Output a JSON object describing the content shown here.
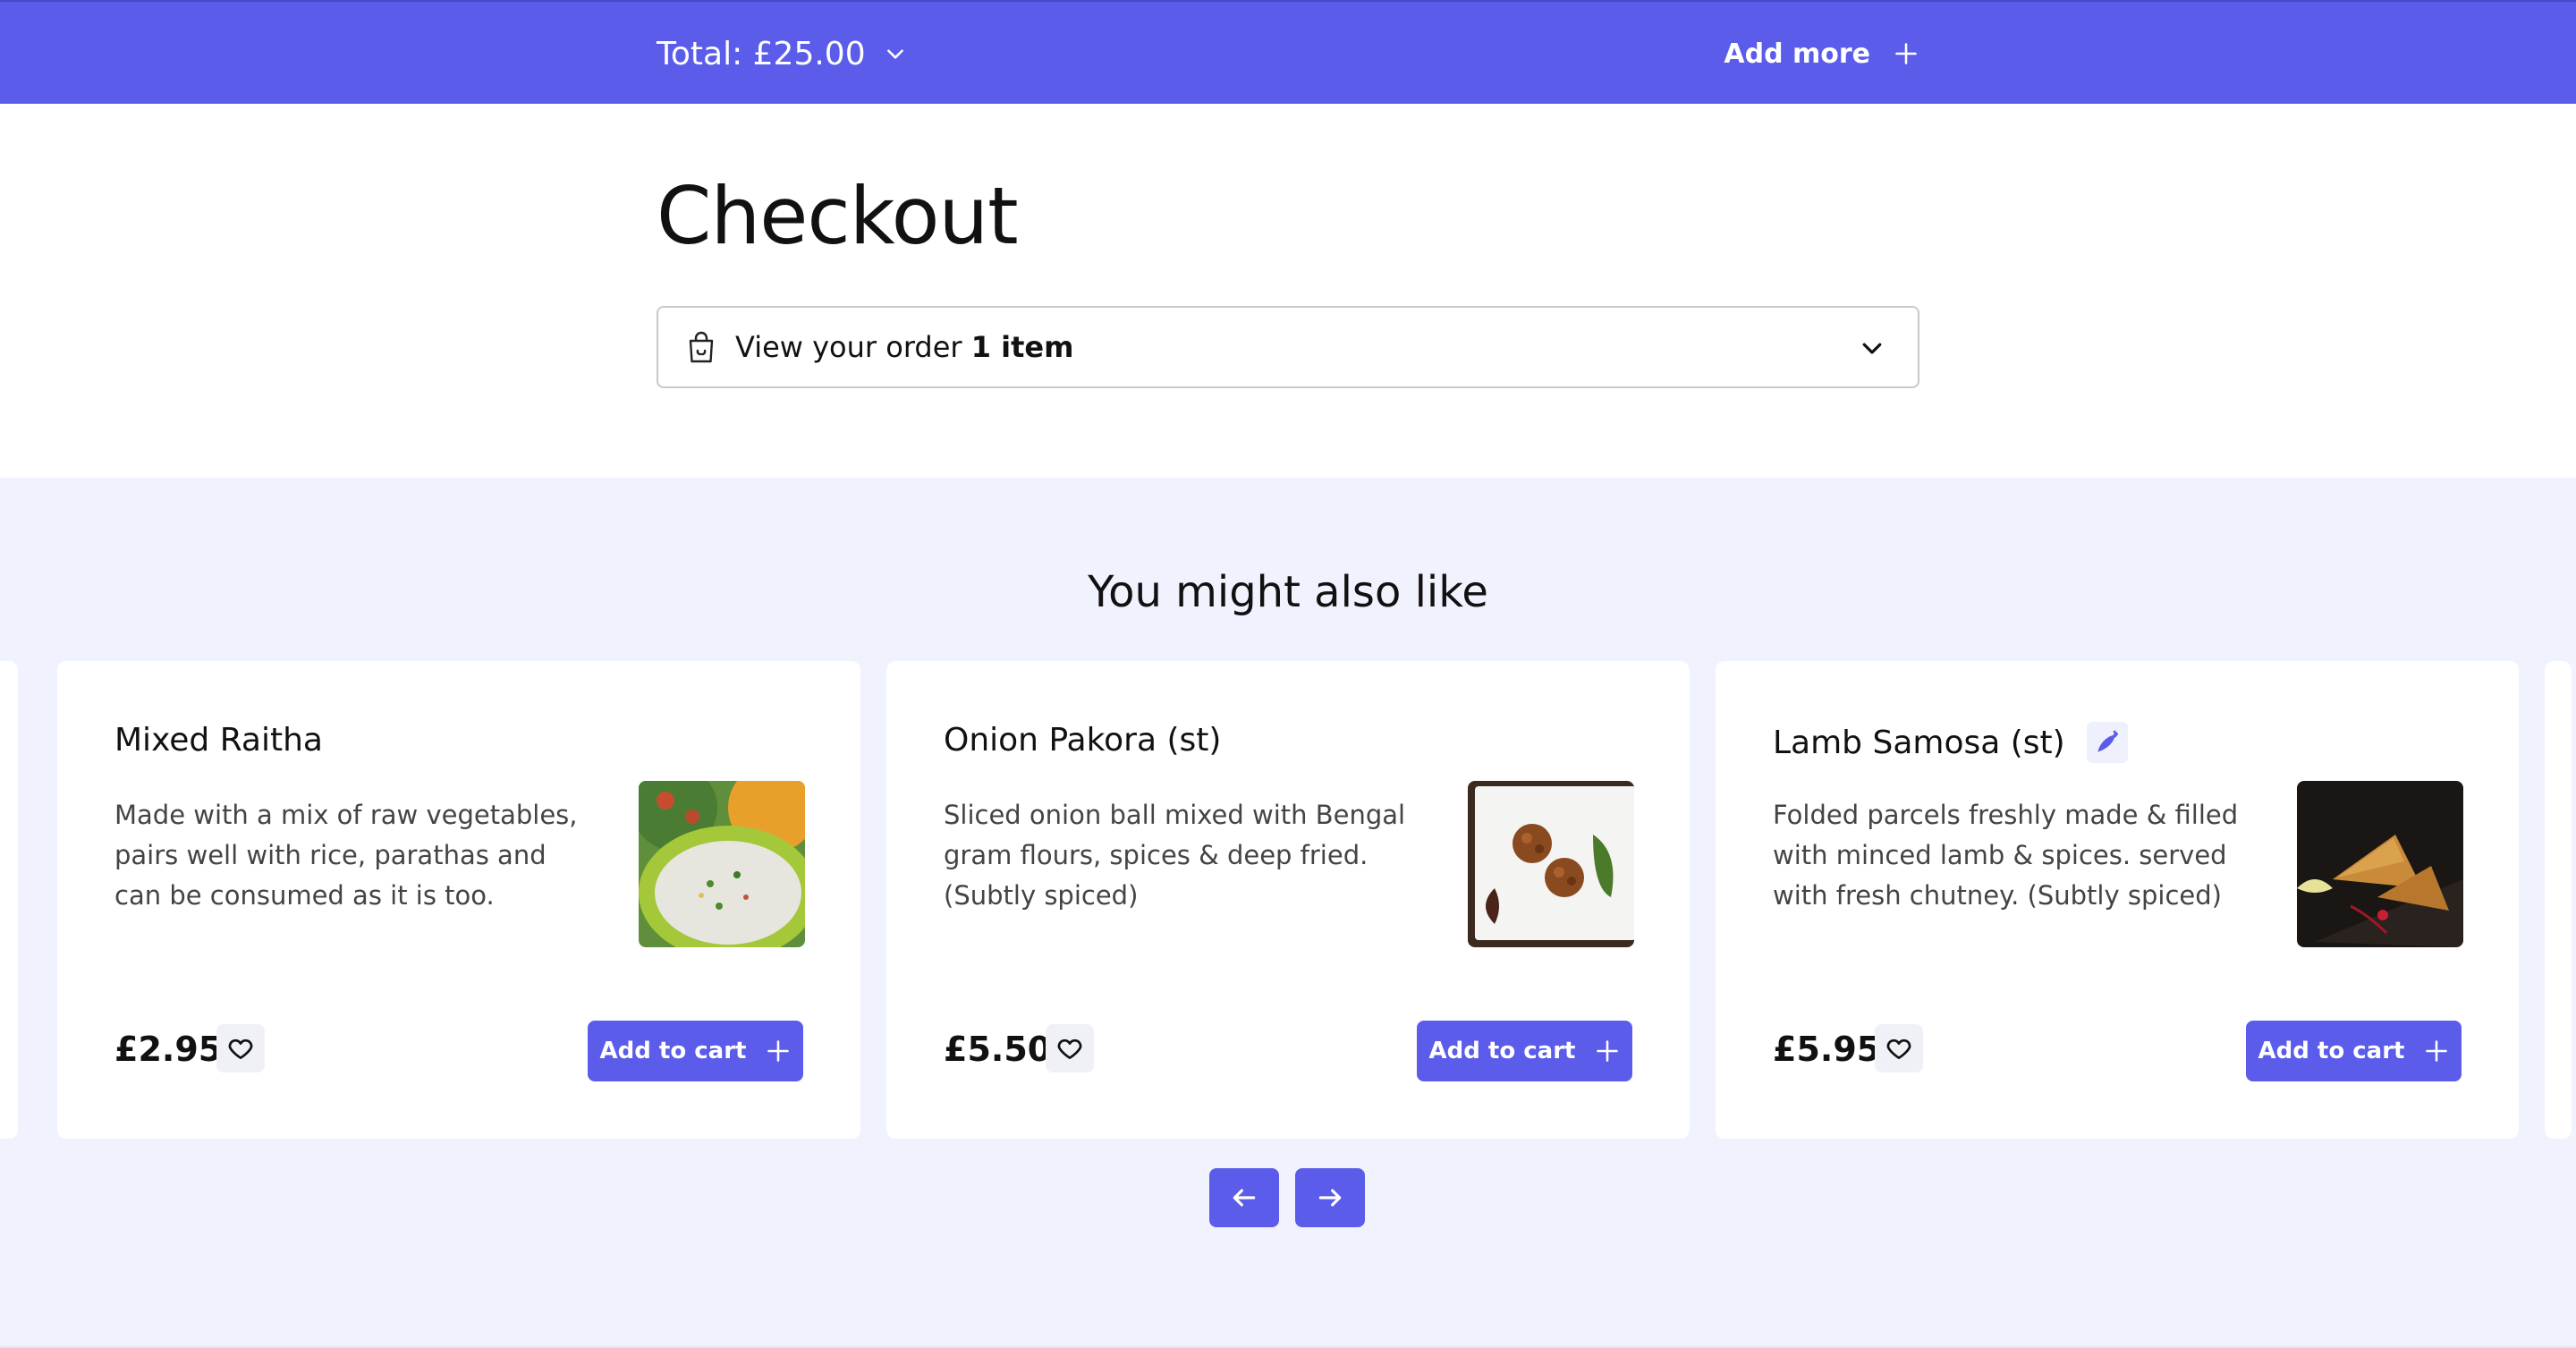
{
  "topbar": {
    "total_label": "Total: £25.00",
    "add_more_label": "Add more",
    "background": "#5b5ce9"
  },
  "page": {
    "title": "Checkout"
  },
  "order": {
    "prefix": "View your order",
    "count": "1 item"
  },
  "recommendations": {
    "title": "You might also like",
    "add_to_cart_label": "Add to cart",
    "items": [
      {
        "name": "Mixed Raitha",
        "description": "Made with a mix of raw vegetables, pairs well with rice, parathas and can be consumed as it is too.",
        "price": "£2.95",
        "spicy": false
      },
      {
        "name": "Onion Pakora (st)",
        "description": "Sliced onion ball mixed with Bengal gram flours, spices & deep fried. (Subtly spiced)",
        "price": "£5.50",
        "spicy": false
      },
      {
        "name": "Lamb Samosa (st)",
        "description": "Folded parcels freshly made & filled with minced lamb & spices. served with fresh chutney. (Subtly spiced)",
        "price": "£5.95",
        "spicy": true
      }
    ]
  },
  "colors": {
    "accent": "#5b5ce9",
    "section_bg": "#f0f2fd"
  },
  "icons": [
    "chevron-down-icon",
    "plus-icon",
    "shopping-bag-icon",
    "heart-icon",
    "chili-icon",
    "arrow-left-icon",
    "arrow-right-icon"
  ]
}
